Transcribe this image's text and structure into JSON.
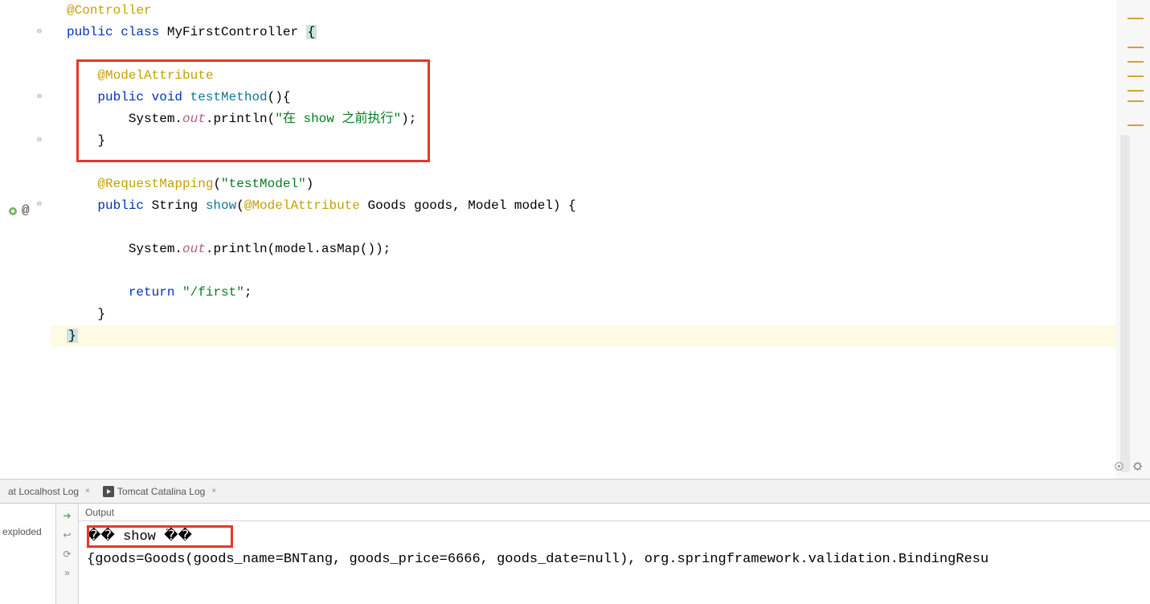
{
  "code": {
    "lines": [
      {
        "type": "annotation",
        "indent": 0,
        "content": "@Controller"
      },
      {
        "type": "class-decl",
        "indent": 0,
        "tokens": [
          "public",
          " ",
          "class",
          " ",
          "MyFirstController",
          " "
        ],
        "highlighted": "{"
      },
      {
        "type": "blank"
      },
      {
        "type": "annotation",
        "indent": 1,
        "content": "@ModelAttribute"
      },
      {
        "type": "method-decl",
        "indent": 1,
        "parts": {
          "mods": "public void ",
          "name": "testMethod",
          "after": "(){"
        }
      },
      {
        "type": "println",
        "indent": 2,
        "parts": {
          "pre": "System.",
          "field": "out",
          "call": ".println(",
          "str": "\"在 show 之前执行\"",
          "after": ");"
        }
      },
      {
        "type": "brace",
        "indent": 1,
        "content": "}"
      },
      {
        "type": "blank"
      },
      {
        "type": "annotation-call",
        "indent": 1,
        "parts": {
          "anno": "@RequestMapping",
          "args": "(\"testModel\")"
        }
      },
      {
        "type": "method-decl2",
        "indent": 1,
        "parts": {
          "mods": "public ",
          "ret": "String ",
          "name": "show",
          "after": "(",
          "anno": "@ModelAttribute",
          "params": " Goods goods, Model model) {"
        }
      },
      {
        "type": "blank"
      },
      {
        "type": "println2",
        "indent": 2,
        "parts": {
          "pre": "System.",
          "field": "out",
          "after": ".println(model.asMap());"
        }
      },
      {
        "type": "blank"
      },
      {
        "type": "return",
        "indent": 2,
        "parts": {
          "kw": "return ",
          "str": "\"/first\"",
          "after": ";"
        }
      },
      {
        "type": "brace",
        "indent": 1,
        "content": "}"
      },
      {
        "type": "brace-hl",
        "indent": 0,
        "content": "}"
      }
    ]
  },
  "minimap": {
    "lines": [
      22,
      58,
      76,
      94,
      112,
      125,
      155
    ]
  },
  "panel": {
    "tab1_label": "at Localhost Log",
    "tab2_label": "Tomcat Catalina Log",
    "left_label": "exploded",
    "output_header": "Output",
    "output_lines": [
      "�� show ֮��",
      "{goods=Goods(goods_name=BNTang, goods_price=6666, goods_date=null), org.springframework.validation.BindingResu"
    ]
  },
  "gutter": {
    "at_symbol": "@"
  }
}
